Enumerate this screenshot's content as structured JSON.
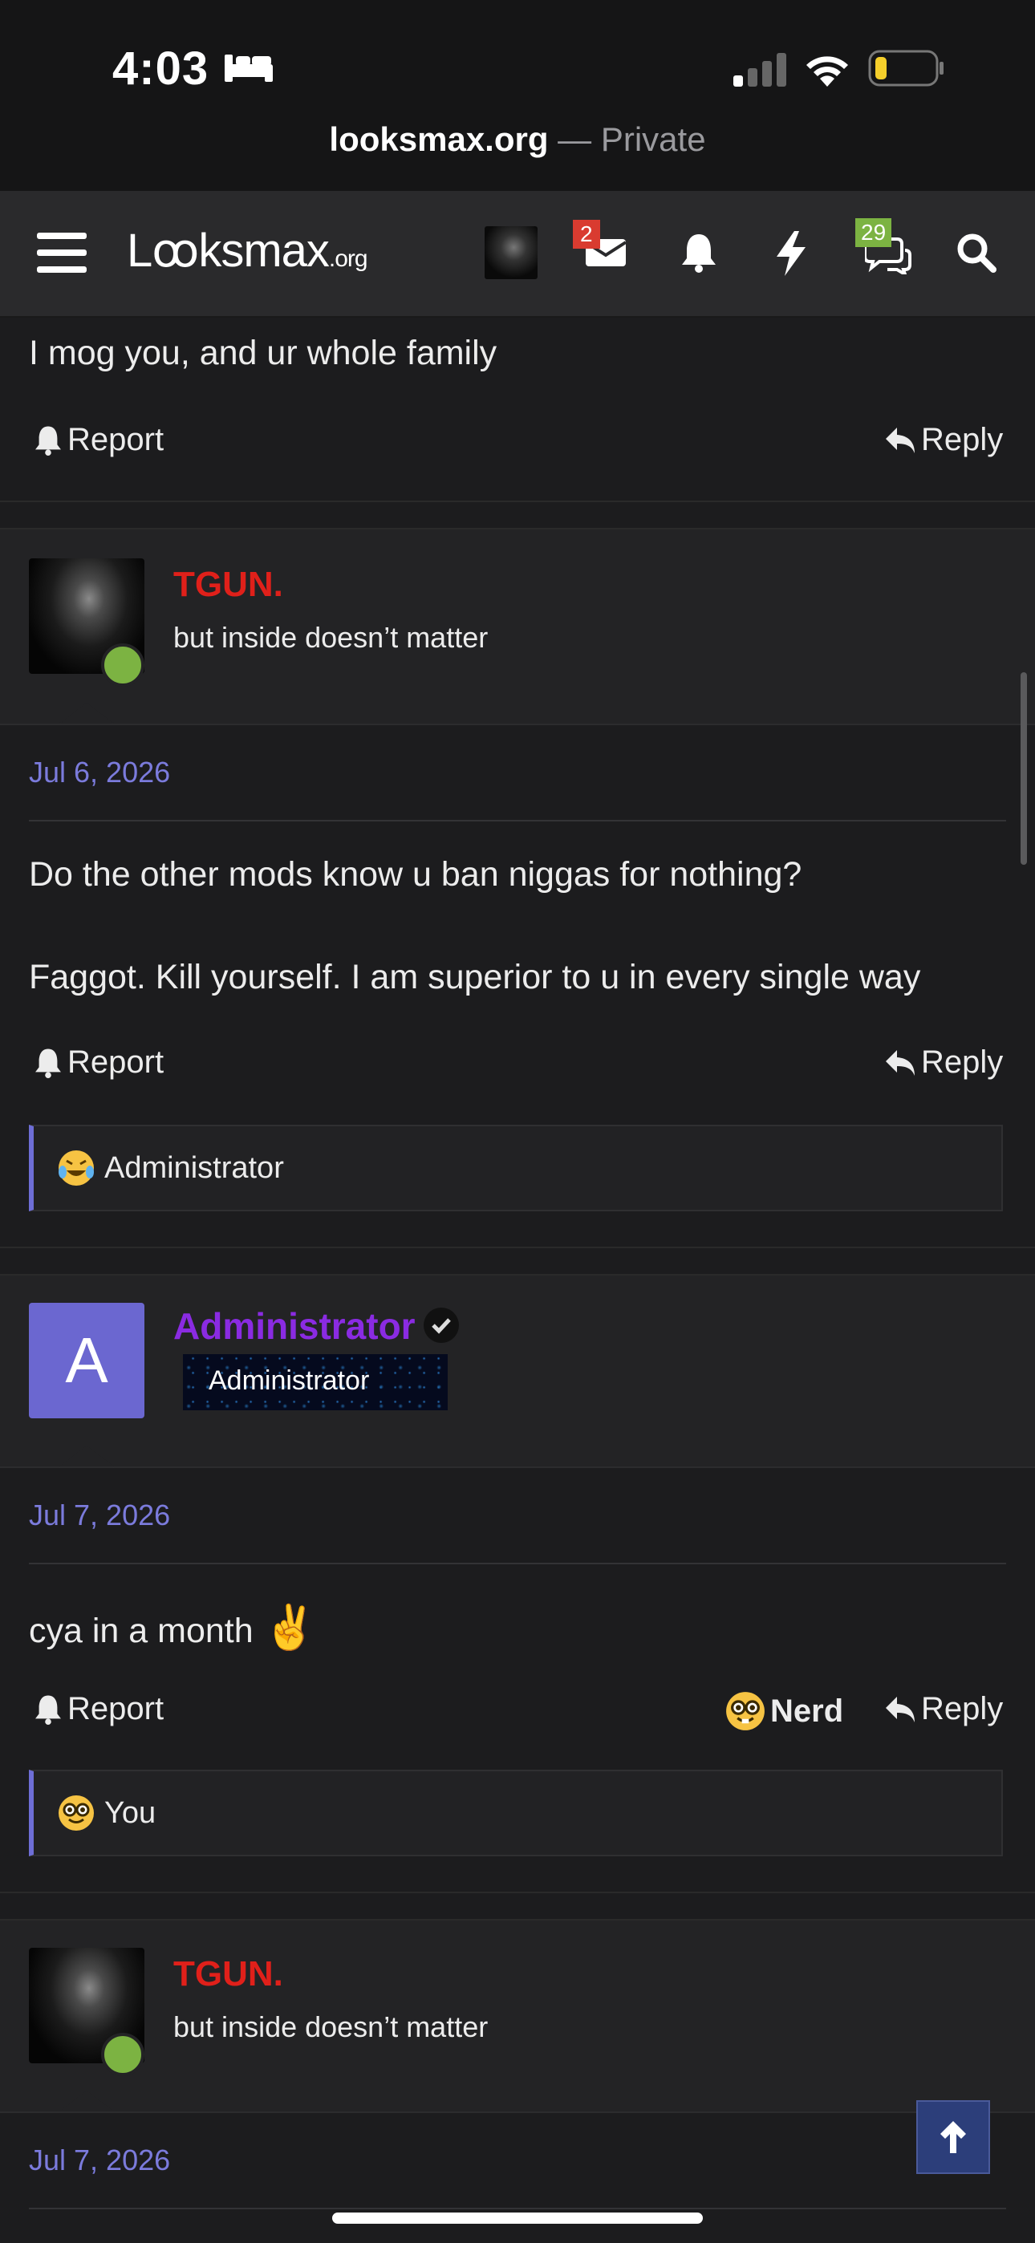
{
  "status": {
    "time": "4:03"
  },
  "url": {
    "domain": "looksmax.org",
    "suffix": " — Private"
  },
  "nav": {
    "logo_main": "Lꝏksmax",
    "logo_org": ".org",
    "inbox_count": "2",
    "chat_count": "29"
  },
  "post0": {
    "text": "I mog you, and ur whole family",
    "report": "Report",
    "reply": "Reply"
  },
  "post1": {
    "username": "TGUN.",
    "usertitle": "but inside doesn’t matter",
    "date": "Jul 6, 2026",
    "lines": [
      "Do the other mods know u ban niggas for nothing?",
      "Faggot. Kill yourself. I am superior to u in every single way"
    ],
    "report": "Report",
    "reply": "Reply",
    "reaction_by": "Administrator"
  },
  "post2": {
    "avatar_letter": "A",
    "username": "Administrator",
    "banner": "Administrator",
    "date": "Jul 7, 2026",
    "text": "cya in a month",
    "emoji": "✌️",
    "report": "Report",
    "react_label": "Nerd",
    "reply": "Reply",
    "reaction_by": "You"
  },
  "post3": {
    "username": "TGUN.",
    "usertitle": "but inside doesn’t matter",
    "date": "Jul 7, 2026"
  },
  "colors": {
    "username_red": "#e0201a",
    "admin_purple": "#8a2be2",
    "date_blue": "#7b7bdc",
    "online_green": "#7cb342"
  }
}
